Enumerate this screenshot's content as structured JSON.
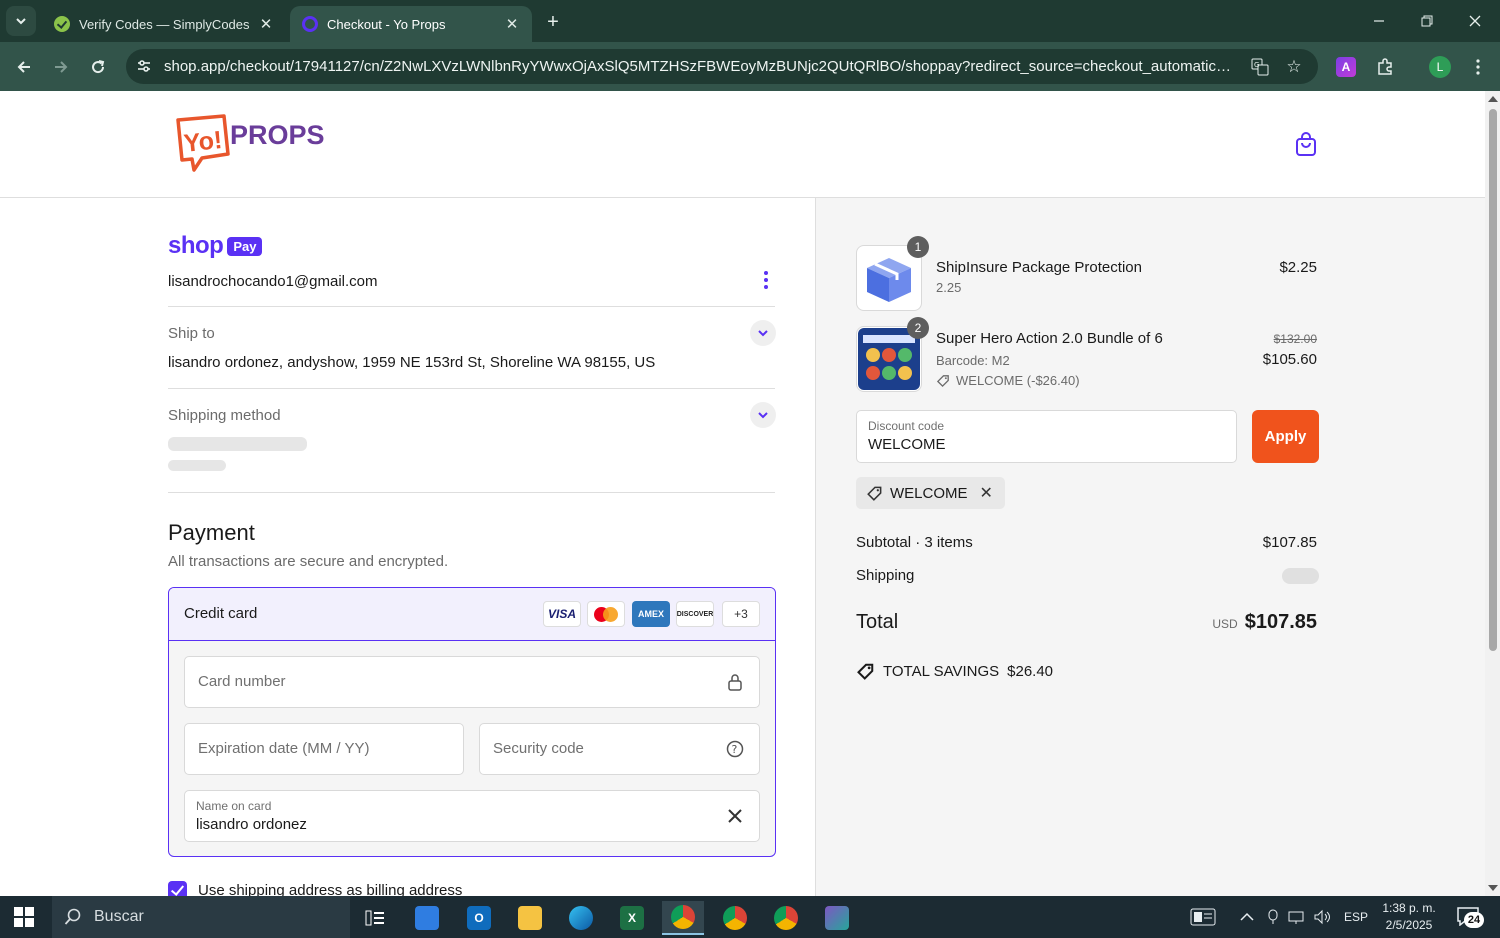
{
  "browser": {
    "tabs": [
      {
        "title": "Verify Codes — SimplyCodes",
        "active": false
      },
      {
        "title": "Checkout - Yo Props",
        "active": true
      }
    ],
    "url": "shop.app/checkout/17941127/cn/Z2NwLXVzLWNlbnRyYWwxOjAxSlQ5MTZHSzFBWEoyMzBUNjc2QUtQRlBO/shoppay?redirect_source=checkout_automatic_redirect...",
    "extension_label": "A",
    "profile_initial": "L"
  },
  "header": {
    "logo_yo": "Yo!",
    "logo_props": "PROPS"
  },
  "checkout": {
    "shoppay": {
      "shop": "shop",
      "pay": "Pay"
    },
    "email": "lisandrochocando1@gmail.com",
    "ship_to_label": "Ship to",
    "ship_to_address": "lisandro ordonez, andyshow, 1959 NE 153rd St, Shoreline WA 98155, US",
    "shipping_method_label": "Shipping method",
    "payment_title": "Payment",
    "payment_subtitle": "All transactions are secure and encrypted.",
    "credit_card_label": "Credit card",
    "card_brands": {
      "visa": "VISA",
      "amex": "AMEX",
      "discover": "DISCOVER",
      "more": "+3"
    },
    "card_number_placeholder": "Card number",
    "expiration_placeholder": "Expiration date (MM / YY)",
    "security_placeholder": "Security code",
    "name_label": "Name on card",
    "name_value": "lisandro ordonez",
    "billing_checkbox_label": "Use shipping address as billing address"
  },
  "summary": {
    "items": [
      {
        "quantity": "1",
        "name": "ShipInsure Package Protection",
        "sub": "2.25",
        "price": "$2.25"
      },
      {
        "quantity": "2",
        "name": "Super Hero Action 2.0 Bundle of 6",
        "sub": "Barcode: M2",
        "discount_tag": "WELCOME (-$26.40)",
        "original_price": "$132.00",
        "price": "$105.60"
      }
    ],
    "discount_label": "Discount code",
    "discount_value": "WELCOME",
    "apply_label": "Apply",
    "applied_code": "WELCOME",
    "subtotal_label": "Subtotal · 3 items",
    "subtotal_value": "$107.85",
    "shipping_label": "Shipping",
    "total_label": "Total",
    "total_currency": "USD",
    "total_value": "$107.85",
    "savings_label": "TOTAL SAVINGS",
    "savings_value": "$26.40"
  },
  "taskbar": {
    "search_label": "Buscar",
    "language": "ESP",
    "time": "1:38 p. m.",
    "date": "2/5/2025",
    "notification_count": "24"
  }
}
